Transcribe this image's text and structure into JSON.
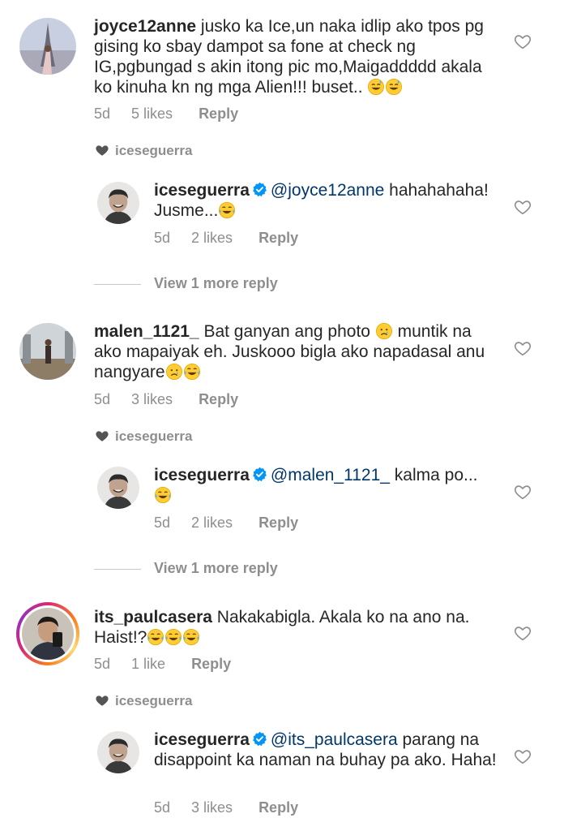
{
  "comments": [
    {
      "user": "joyce12anne",
      "text": " jusko ka Ice,un naka idlip ako tpos pg gising ko sbay dampot sa fone at check ng IG,pgbungad s akin itong pic mo,Maigaddddd akala ko kinuha kn ng mga Alien!!! buset..",
      "emojis": [
        "grinning-sweat-emoji",
        "grinning-sweat-emoji"
      ],
      "ago": "5d",
      "likes": "5 likes",
      "reply": "Reply",
      "liked_by": "iceseguerra",
      "owner_reply": {
        "user": "iceseguerra",
        "mention": "@joyce12anne",
        "text": " hahahahaha! Jusme...",
        "emojis": [
          "tears-of-joy-emoji"
        ],
        "ago": "5d",
        "likes": "2 likes",
        "reply": "Reply"
      },
      "view_more": "View 1 more reply"
    },
    {
      "user": "malen_1121_",
      "text": " Bat ganyan ang photo",
      "text_after_emoji": " muntik na ako mapaiyak eh. Juskooo bigla ako napadasal anu nangyare",
      "emojis": [
        "crying-emoji"
      ],
      "trailing_emojis": [
        "crying-emoji",
        "tears-of-joy-emoji"
      ],
      "ago": "5d",
      "likes": "3 likes",
      "reply": "Reply",
      "liked_by": "iceseguerra",
      "owner_reply": {
        "user": "iceseguerra",
        "mention": "@malen_1121_",
        "text": " kalma po...",
        "emojis": [
          "tears-of-joy-emoji"
        ],
        "ago": "5d",
        "likes": "2 likes",
        "reply": "Reply"
      },
      "view_more": "View 1 more reply"
    },
    {
      "user": "its_paulcasera",
      "text": " Nakakabigla. Akala ko na ano na. Haist!?",
      "emojis": [
        "tears-of-joy-emoji",
        "tears-of-joy-emoji",
        "tears-of-joy-emoji"
      ],
      "ago": "5d",
      "likes": "1 like",
      "reply": "Reply",
      "liked_by": "iceseguerra",
      "owner_reply": {
        "user": "iceseguerra",
        "mention": "@its_paulcasera",
        "text": " parang na disappoint ka naman na buhay pa ako. Haha!",
        "ago": "5d",
        "likes": "3 likes",
        "reply": "Reply"
      }
    }
  ],
  "colors": {
    "text": "#262626",
    "muted": "#8e8e8e",
    "mention": "#00376b",
    "verified": "#0095f6"
  }
}
